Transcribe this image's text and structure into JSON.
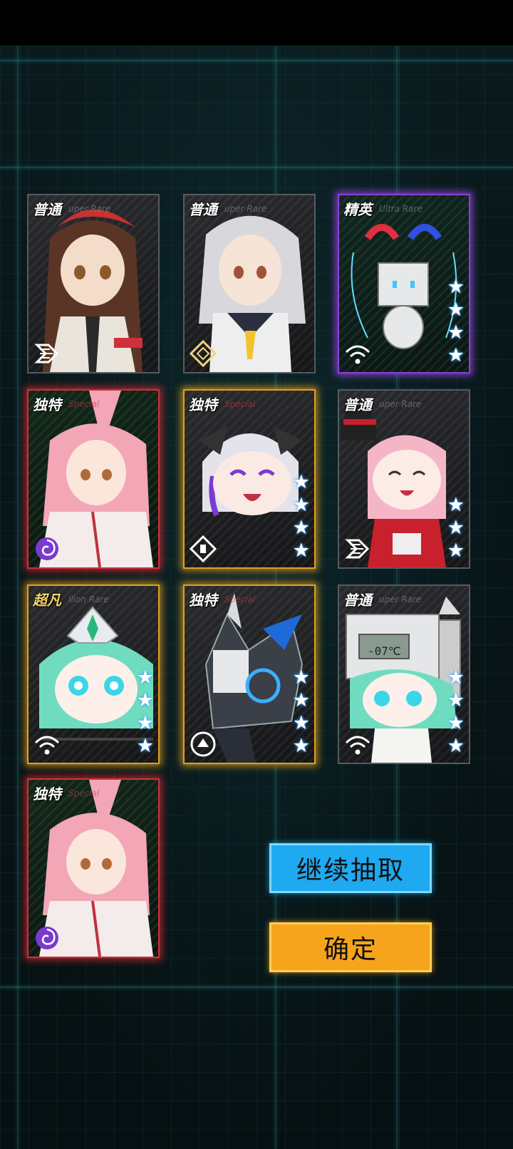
{
  "cards": [
    {
      "rarity": "普通",
      "sub": "uper Rare",
      "stars": 0,
      "class_icon": "assault-icon"
    },
    {
      "rarity": "普通",
      "sub": "uper Rare",
      "stars": 0,
      "class_icon": "diamond-icon"
    },
    {
      "rarity": "精英",
      "sub": "Ultra Rare",
      "stars": 4,
      "class_icon": "wifi-icon"
    },
    {
      "rarity": "独特",
      "sub": "Special",
      "stars": 0,
      "class_icon": "spiral-icon"
    },
    {
      "rarity": "独特",
      "sub": "Special",
      "stars": 4,
      "class_icon": "diamond-dot-icon"
    },
    {
      "rarity": "普通",
      "sub": "uper Rare",
      "stars": 3,
      "class_icon": "assault-icon"
    },
    {
      "rarity": "超凡",
      "sub": "llion Rare",
      "stars": 4,
      "class_icon": "wifi-icon"
    },
    {
      "rarity": "独特",
      "sub": "Special",
      "stars": 4,
      "class_icon": "shield-icon"
    },
    {
      "rarity": "普通",
      "sub": "uper Rare",
      "stars": 4,
      "class_icon": "wifi-icon"
    },
    {
      "rarity": "独特",
      "sub": "Special",
      "stars": 0,
      "class_icon": "spiral-icon"
    }
  ],
  "display_temp": "-07℃",
  "buttons": {
    "continue_label": "继续抽取",
    "confirm_label": "确定"
  },
  "colors": {
    "continue_button": "#1ea9f0",
    "confirm_button": "#f5a41c",
    "glow_purple": "#8a3fd6",
    "glow_red": "#d0303a",
    "glow_gold": "#e0a020"
  }
}
